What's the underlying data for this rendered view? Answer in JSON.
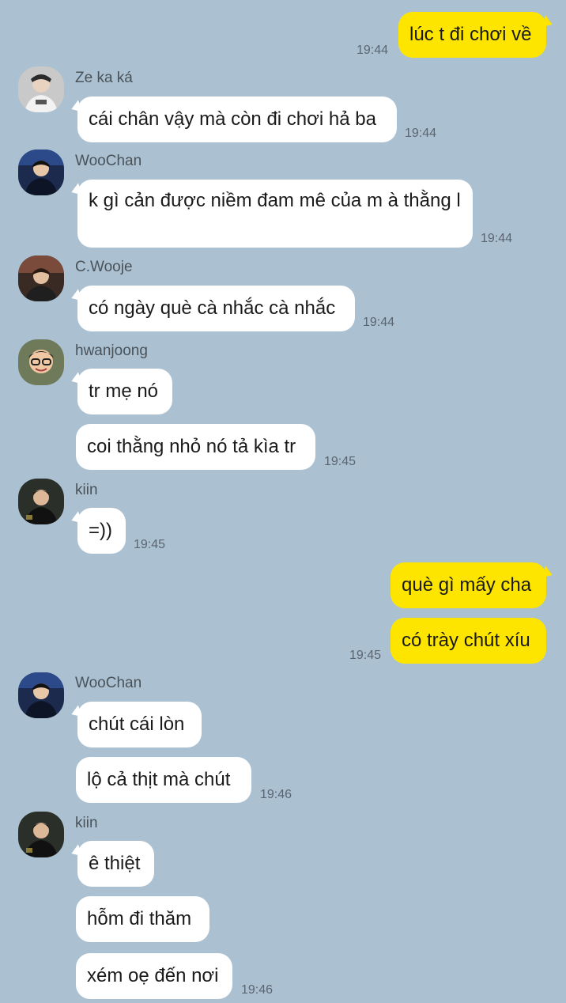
{
  "chat": {
    "m1": {
      "text": "lúc t đi chơi về",
      "time": "19:44"
    },
    "m2": {
      "sender": "Ze ka ká",
      "text": "cái chân vậy mà còn đi chơi hả ba",
      "time": "19:44"
    },
    "m3": {
      "sender": "WooChan",
      "text": "k gì cản được niềm đam mê của m à thằng l",
      "time": "19:44"
    },
    "m4": {
      "sender": "C.Wooje",
      "text": "có ngày què cà nhắc cà nhắc",
      "time": "19:44"
    },
    "m5": {
      "sender": "hwanjoong",
      "text": "tr mẹ nó"
    },
    "m6": {
      "text": "coi thằng nhỏ nó tả kìa tr",
      "time": "19:45"
    },
    "m7": {
      "sender": "kiin",
      "text": "=))",
      "time": "19:45"
    },
    "m8": {
      "text": "què gì mấy cha"
    },
    "m9": {
      "text": "có trày chút xíu",
      "time": "19:45"
    },
    "m10": {
      "sender": "WooChan",
      "text": "chút cái lòn"
    },
    "m11": {
      "text": "lộ cả thịt mà chút",
      "time": "19:46"
    },
    "m12": {
      "sender": "kiin",
      "text": "ê thiệt"
    },
    "m13": {
      "text": "hỗm đi thăm"
    },
    "m14": {
      "text": "xém oẹ đến nơi",
      "time": "19:46"
    }
  },
  "colors": {
    "background": "#abc1d1",
    "incoming_bubble": "#ffffff",
    "outgoing_bubble": "#fee500"
  }
}
